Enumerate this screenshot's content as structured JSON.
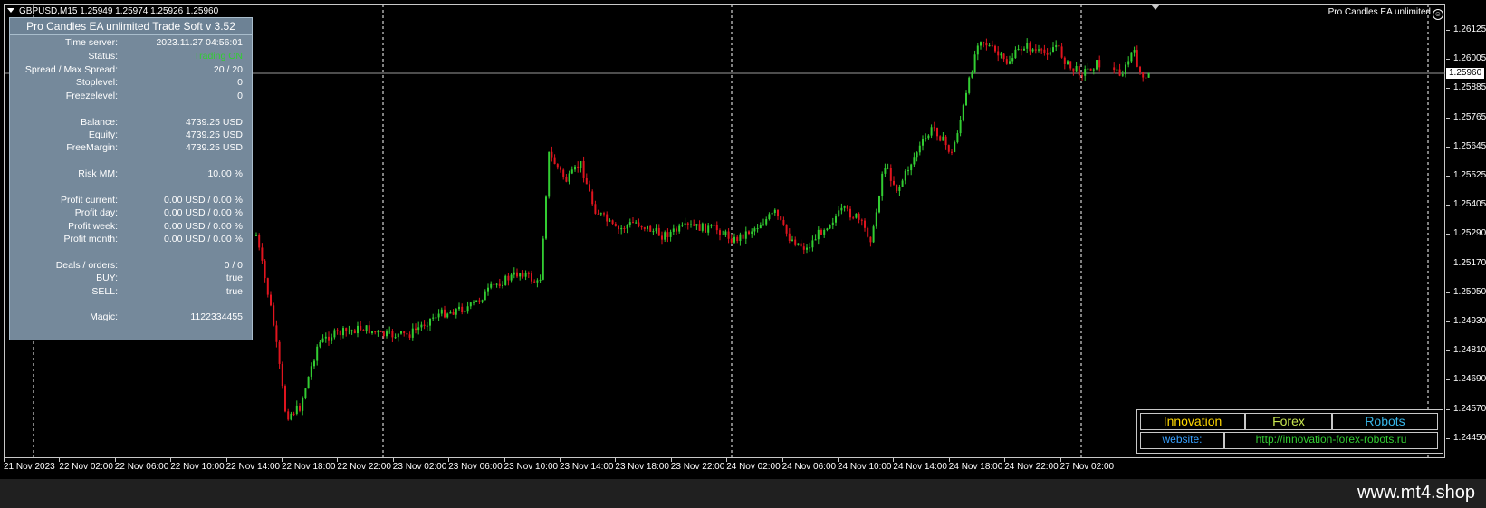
{
  "symbol_header": "GBPUSD,M15  1.25949 1.25974 1.25926 1.25960",
  "ea_label": "Pro Candles EA unlimited",
  "smiley_glyph": "☺",
  "current_price": "1.25960",
  "price_ticks": [
    "1.26125",
    "1.26005",
    "1.25885",
    "1.25765",
    "1.25645",
    "1.25525",
    "1.25405",
    "1.25290",
    "1.25170",
    "1.25050",
    "1.24930",
    "1.24810",
    "1.24690",
    "1.24570",
    "1.24450"
  ],
  "time_labels": [
    "21 Nov 2023",
    "22 Nov 02:00",
    "22 Nov 06:00",
    "22 Nov 10:00",
    "22 Nov 14:00",
    "22 Nov 18:00",
    "22 Nov 22:00",
    "23 Nov 02:00",
    "23 Nov 06:00",
    "23 Nov 10:00",
    "23 Nov 14:00",
    "23 Nov 18:00",
    "23 Nov 22:00",
    "24 Nov 02:00",
    "24 Nov 06:00",
    "24 Nov 10:00",
    "24 Nov 14:00",
    "24 Nov 18:00",
    "24 Nov 22:00",
    "27 Nov 02:00"
  ],
  "panel": {
    "title": "Pro Candles EA unlimited Trade Soft v 3.52",
    "rows": [
      {
        "label": "Time server:",
        "value": "2023.11.27 04:56:01"
      },
      {
        "label": "Status:",
        "value": "Trading ON"
      },
      {
        "label": "Spread  /  Max Spread:",
        "value": "20  /  20"
      },
      {
        "label": "Stoplevel:",
        "value": "0"
      },
      {
        "label": "Freezelevel:",
        "value": "0"
      },
      {
        "label": "Balance:",
        "value": "4739.25  USD"
      },
      {
        "label": "Equity:",
        "value": "4739.25  USD"
      },
      {
        "label": "FreeMargin:",
        "value": "4739.25  USD"
      },
      {
        "label": "Risk MM:",
        "value": "10.00 %"
      },
      {
        "label": "Profit current:",
        "value": "0.00  USD  /  0.00 %"
      },
      {
        "label": "Profit day:",
        "value": "0.00  USD  /  0.00 %"
      },
      {
        "label": "Profit week:",
        "value": "0.00  USD  /  0.00 %"
      },
      {
        "label": "Profit month:",
        "value": "0.00  USD  /  0.00 %"
      },
      {
        "label": "Deals / orders:",
        "value": "0  /  0"
      },
      {
        "label": "BUY:",
        "value": "true"
      },
      {
        "label": "SELL:",
        "value": "true"
      },
      {
        "label": "Magic:",
        "value": "1122334455"
      }
    ]
  },
  "brand": {
    "innovation": "Innovation",
    "forex": "Forex",
    "robots": "Robots",
    "website_label": "website:",
    "website_url": "http://innovation-forex-robots.ru"
  },
  "footer_text": "www.mt4.shop",
  "colors": {
    "bull": "#32cd32",
    "bear": "#e0141e",
    "grid": "#ffffff",
    "innovation": "#ffd700",
    "forex": "#c8e650",
    "robots": "#37b4e6",
    "website_label": "#37a0ff",
    "website_url": "#32cd32",
    "panel_bg": "#75899b"
  }
}
